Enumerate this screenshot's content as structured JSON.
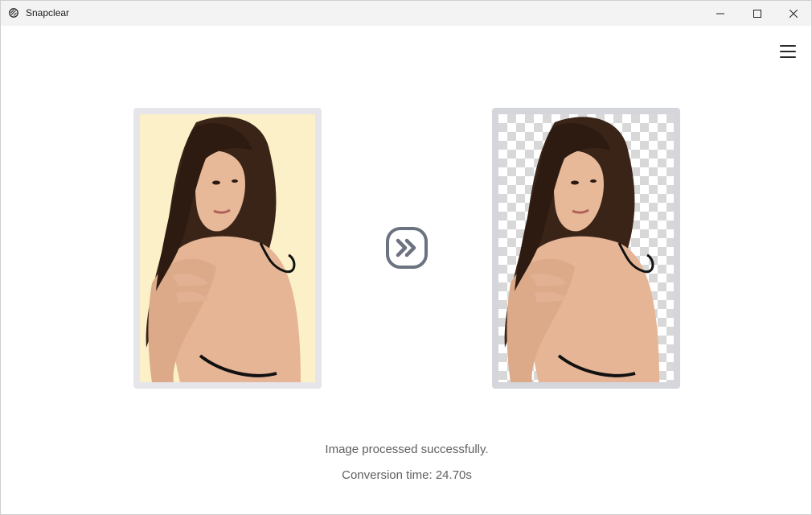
{
  "window": {
    "title": "Snapclear",
    "app_icon": "snapclear-logo-icon",
    "controls": [
      "minimize-icon",
      "maximize-icon",
      "close-icon"
    ]
  },
  "header": {
    "menu_icon": "hamburger-menu-icon"
  },
  "main": {
    "original_image": {
      "subject": "woman-portrait",
      "background": "#fbf0c8"
    },
    "convert_icon": "double-chevron-right-icon",
    "result_image": {
      "subject": "woman-portrait",
      "background": "transparent-checkerboard"
    }
  },
  "status": {
    "message": "Image processed successfully.",
    "conversion_time": "Conversion time: 24.70s"
  },
  "colors": {
    "titlebar": "#f3f3f3",
    "original_frame": "#e6e6ea",
    "result_frame": "#d5d6dc",
    "convert_icon": "#6b7280",
    "status_text": "#5f5f5f"
  }
}
